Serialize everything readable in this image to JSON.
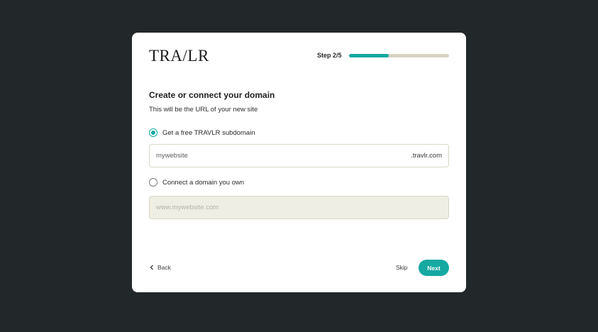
{
  "brand": {
    "logo_text": "TRA/LR"
  },
  "progress": {
    "step_label": "Step 2/5",
    "fraction": 0.4,
    "fill_color": "#15a9a2",
    "track_color": "#d6d3c4"
  },
  "form": {
    "title": "Create or connect your domain",
    "subtitle": "This will be the URL of your new site",
    "options": [
      {
        "label": "Get a free TRAVLR subdomain",
        "selected": true
      },
      {
        "label": "Connect a domain you own",
        "selected": false
      }
    ],
    "subdomain_input": {
      "value": "mywebsite",
      "suffix": ".travlr.com"
    },
    "custom_domain_input": {
      "placeholder": "www.mywebsite.com"
    }
  },
  "footer": {
    "back_label": "Back",
    "back_icon": "chevron-left-icon",
    "skip_label": "Skip",
    "next_label": "Next"
  },
  "colors": {
    "accent": "#15a9a2",
    "background": "#22282a"
  }
}
